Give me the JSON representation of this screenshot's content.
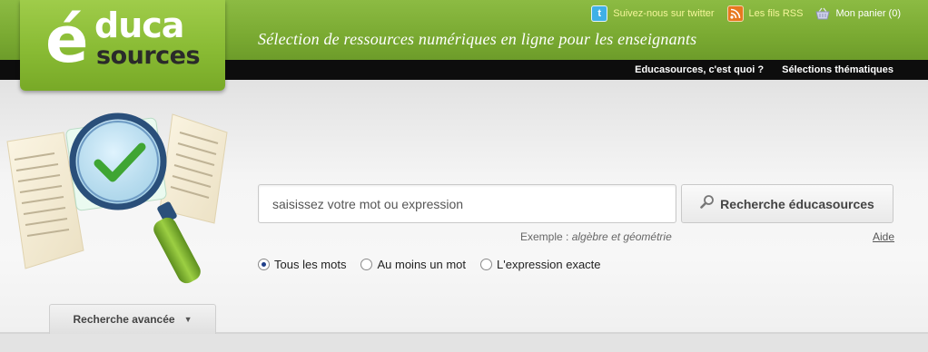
{
  "header": {
    "tagline": "Sélection de ressources numériques en ligne pour les enseignants",
    "toplinks": [
      {
        "label": "Suivez-nous sur twitter",
        "icon": "twitter-icon"
      },
      {
        "label": "Les fils RSS",
        "icon": "rss-icon"
      },
      {
        "label": "Mon panier (0)",
        "icon": "basket-icon"
      }
    ]
  },
  "logo": {
    "e": "é",
    "duca": "duca",
    "sources": "sources"
  },
  "nav": {
    "items": [
      "Educasources, c'est quoi ?",
      "Sélections thématiques"
    ]
  },
  "search": {
    "placeholder": "saisissez votre mot ou expression",
    "button_label": "Recherche éducasources",
    "example_prefix": "Exemple : ",
    "example_value": "algèbre et géométrie",
    "help_label": "Aide",
    "options": [
      {
        "label": "Tous les mots",
        "selected": true
      },
      {
        "label": "Au moins un mot",
        "selected": false
      },
      {
        "label": "L'expression exacte",
        "selected": false
      }
    ]
  },
  "advanced": {
    "label": "Recherche avancée"
  },
  "colors": {
    "brand_green": "#7aaa32",
    "logo_green": "#89bb34",
    "nav_black": "#0d0d0d",
    "link_yellow": "#f4f59a"
  }
}
